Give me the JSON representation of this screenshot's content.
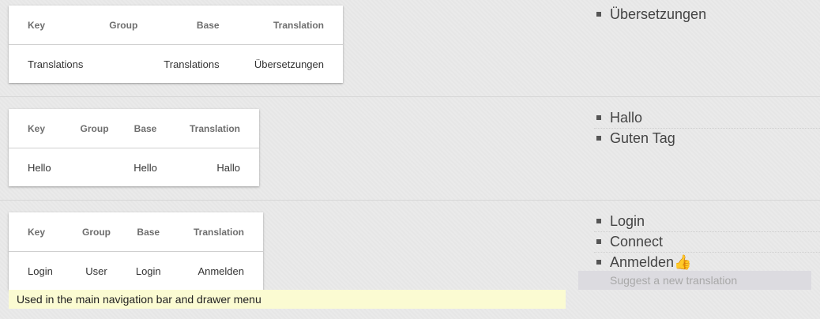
{
  "columns": {
    "key": "Key",
    "group": "Group",
    "base": "Base",
    "translation": "Translation"
  },
  "entries": [
    {
      "key": "Translations",
      "group": "",
      "base": "Translations",
      "translation": "Übersetzungen",
      "suggestions": [
        "Übersetzungen"
      ]
    },
    {
      "key": "Hello",
      "group": "",
      "base": "Hello",
      "translation": "Hallo",
      "suggestions": [
        "Hallo",
        "Guten Tag"
      ]
    },
    {
      "key": "Login",
      "group": "User",
      "base": "Login",
      "translation": "Anmelden",
      "suggestions": [
        "Login",
        "Connect",
        "Anmelden👍"
      ],
      "suggest_placeholder": "Suggest a new translation",
      "note": "Used in the main navigation bar and drawer menu"
    }
  ]
}
